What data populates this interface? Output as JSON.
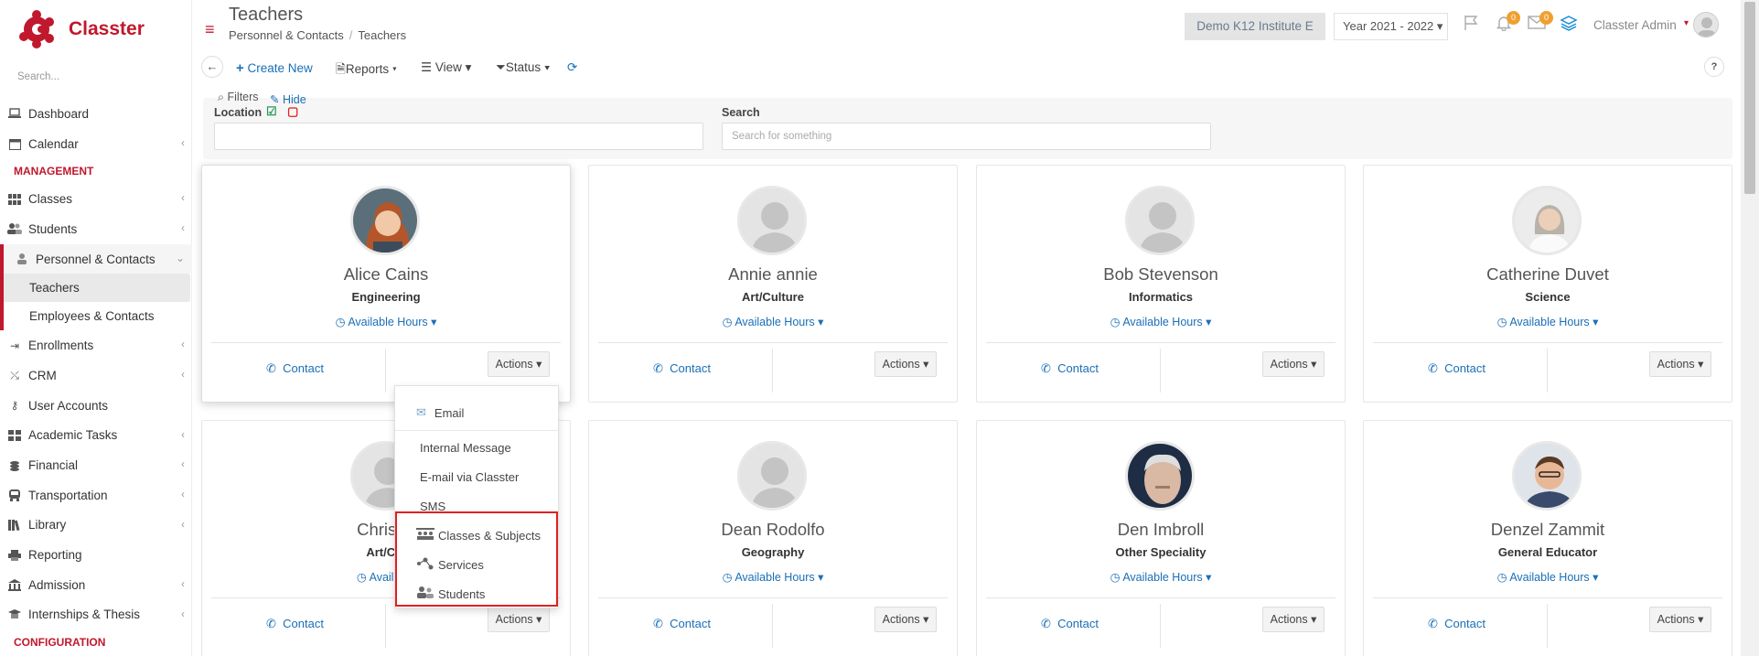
{
  "app": {
    "name": "Classter",
    "accent": "#c0182d",
    "link_color": "#1a6fb6"
  },
  "sidebar": {
    "search_placeholder": "Search...",
    "items": [
      {
        "label": "Dashboard",
        "icon": "laptop-icon"
      },
      {
        "label": "Calendar",
        "icon": "calendar-icon"
      }
    ],
    "section_management": "MANAGEMENT",
    "management_items": [
      {
        "label": "Classes",
        "icon": "grid-icon"
      },
      {
        "label": "Students",
        "icon": "users-icon"
      },
      {
        "label": "Personnel & Contacts",
        "icon": "person-icon"
      }
    ],
    "sub_items": [
      {
        "label": "Teachers"
      },
      {
        "label": "Employees & Contacts"
      }
    ],
    "more_items": [
      {
        "label": "Enrollments",
        "icon": "enroll-icon"
      },
      {
        "label": "CRM",
        "icon": "crm-icon"
      },
      {
        "label": "User Accounts",
        "icon": "key-icon"
      },
      {
        "label": "Academic Tasks",
        "icon": "tasks-icon"
      },
      {
        "label": "Financial",
        "icon": "coins-icon"
      },
      {
        "label": "Transportation",
        "icon": "bus-icon"
      },
      {
        "label": "Library",
        "icon": "books-icon"
      },
      {
        "label": "Reporting",
        "icon": "print-icon"
      },
      {
        "label": "Admission",
        "icon": "bank-icon"
      },
      {
        "label": "Internships & Thesis",
        "icon": "internship-icon"
      }
    ],
    "section_configuration": "CONFIGURATION"
  },
  "header": {
    "title": "Teachers",
    "breadcrumb": [
      "Personnel & Contacts",
      "Teachers"
    ],
    "institute": "Demo K12 Institute E",
    "year": "Year 2021 - 2022",
    "notifications_count": "0",
    "messages_count": "0",
    "user": "Classter Admin"
  },
  "toolbar": {
    "create_new": "Create New",
    "reports": "Reports",
    "view": "View",
    "status": "Status",
    "help": "?"
  },
  "filters": {
    "title": "Filters",
    "hide": "Hide",
    "location_label": "Location",
    "search_label": "Search",
    "search_placeholder": "Search for something"
  },
  "teachers": [
    {
      "name": "Alice Cains",
      "subject": "Engineering",
      "hours": "Available Hours",
      "contact": "Contact",
      "actions": "Actions",
      "photo": "female-photo"
    },
    {
      "name": "Annie annie",
      "subject": "Art/Culture",
      "hours": "Available Hours",
      "contact": "Contact",
      "actions": "Actions",
      "photo": "placeholder"
    },
    {
      "name": "Bob Stevenson",
      "subject": "Informatics",
      "hours": "Available Hours",
      "contact": "Contact",
      "actions": "Actions",
      "photo": "placeholder"
    },
    {
      "name": "Catherine Duvet",
      "subject": "Science",
      "hours": "Available Hours",
      "contact": "Contact",
      "actions": "Actions",
      "photo": "female-photo"
    },
    {
      "name": "Chris M",
      "subject": "Art/Cul",
      "hours": "Available",
      "contact": "Contact",
      "actions": "Actions",
      "photo": "placeholder"
    },
    {
      "name": "Dean Rodolfo",
      "subject": "Geography",
      "hours": "Available Hours",
      "contact": "Contact",
      "actions": "Actions",
      "photo": "placeholder"
    },
    {
      "name": "Den Imbroll",
      "subject": "Other Speciality",
      "hours": "Available Hours",
      "contact": "Contact",
      "actions": "Actions",
      "photo": "male-photo"
    },
    {
      "name": "Denzel Zammit",
      "subject": "General Educator",
      "hours": "Available Hours",
      "contact": "Contact",
      "actions": "Actions",
      "photo": "male-photo"
    }
  ],
  "actions_menu": {
    "items": [
      "Email",
      "Internal Message",
      "E-mail via Classter",
      "SMS",
      "Classes & Subjects",
      "Services",
      "Students"
    ]
  }
}
